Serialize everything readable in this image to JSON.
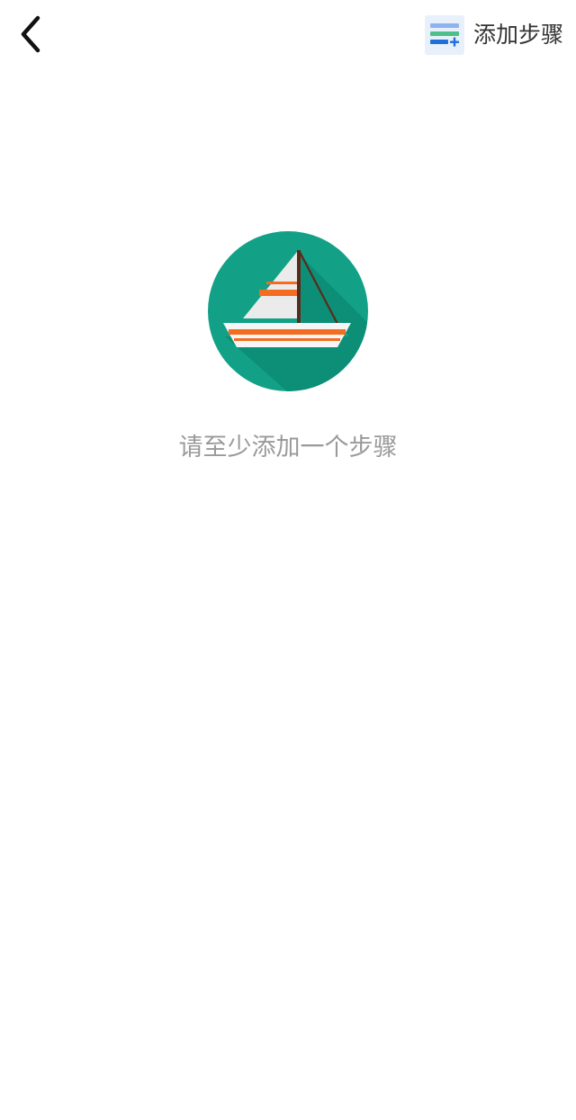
{
  "header": {
    "back_icon": "chevron-left-icon",
    "add_step_icon": "add-list-icon",
    "add_step_label": "添加步骤"
  },
  "empty_state": {
    "illustration": "sailboat-icon",
    "message": "请至少添加一个步骤"
  },
  "colors": {
    "teal": "#12a187",
    "orange": "#f36c21",
    "blue": "#1e6fd9",
    "green": "#4cbf8a"
  }
}
